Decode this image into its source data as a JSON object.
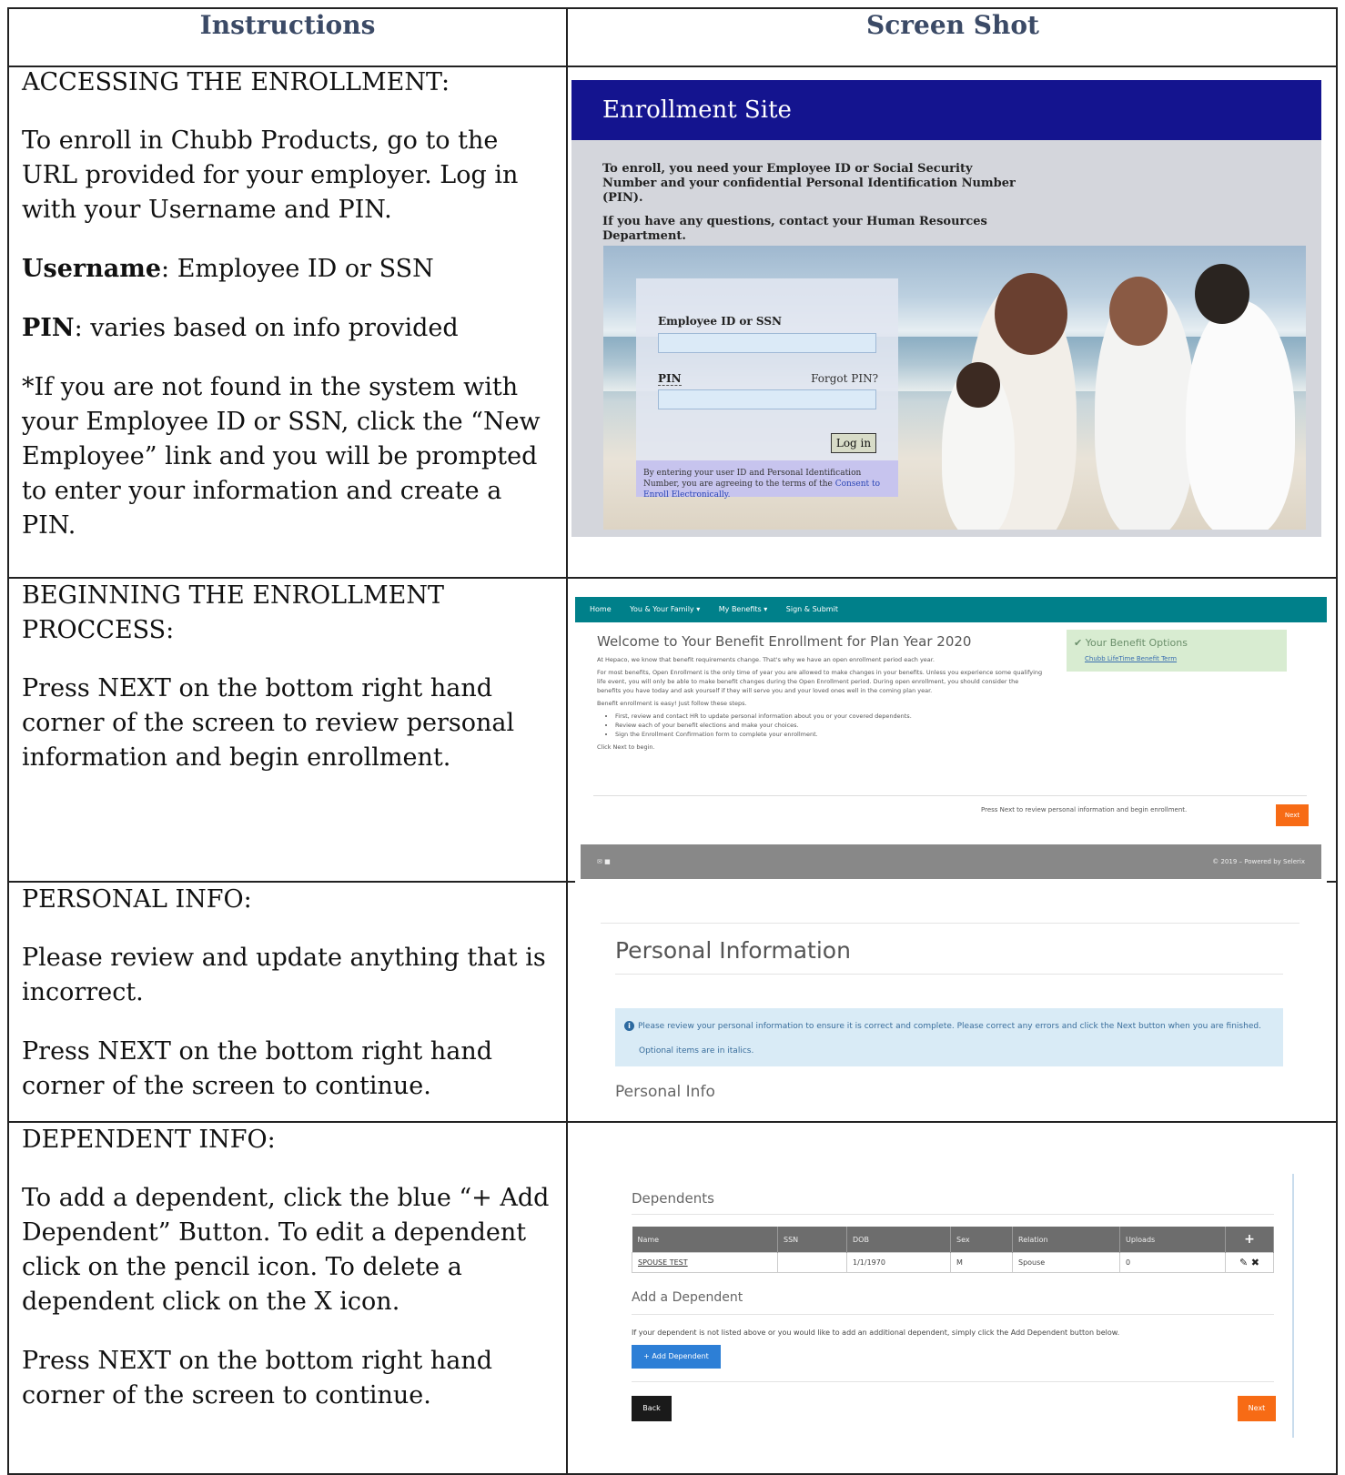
{
  "headers": {
    "instructions": "Instructions",
    "screenshot": "Screen Shot"
  },
  "sections": {
    "access": {
      "heading": "ACCESSING THE ENROLLMENT:",
      "body": "To enroll in Chubb Products, go to the URL provided for your employer. Log in with your Username and PIN.",
      "username_label": "Username",
      "username_value": ": Employee ID or SSN",
      "pin_label": "PIN",
      "pin_value": ": varies based on info provided",
      "note": "*If you are not found in the system with your Employee ID or SSN, click the “New Employee” link and you will be prompted to enter your information and create a PIN."
    },
    "begin": {
      "heading": "BEGINNING THE ENROLLMENT PROCCESS:",
      "body": "Press NEXT on the bottom right hand corner of the screen to review personal information and begin enrollment."
    },
    "personal": {
      "heading": "PERSONAL INFO:",
      "body": "Please review and update anything that is incorrect.",
      "body2": "Press NEXT on the bottom right hand corner of the screen to continue."
    },
    "dependent": {
      "heading": "DEPENDENT INFO:",
      "body": "To add a dependent, click the blue “+ Add Dependent” Button. To edit a dependent click on the pencil icon. To delete a dependent click on the X icon.",
      "body2": "Press NEXT on the bottom right hand corner of the screen to continue."
    }
  },
  "shot1": {
    "banner": "Enrollment Site",
    "intro1": "To enroll, you need your Employee ID or Social Security Number and your confidential Personal Identification Number (PIN).",
    "intro2": "If you have any questions, contact your Human Resources Department.",
    "id_label": "Employee ID or SSN",
    "pin_label": "PIN",
    "forgot": "Forgot PIN?",
    "login_btn": "Log in",
    "consent_text": "By entering your user ID and Personal Identification Number, you are agreeing to the terms of the ",
    "consent_link": "Consent to Enroll Electronically."
  },
  "shot2": {
    "nav": [
      "Home",
      "You & Your Family ▾",
      "My Benefits ▾",
      "Sign & Submit"
    ],
    "title": "Welcome to Your Benefit Enrollment for Plan Year 2020",
    "p1": "At Hepaco, we know that benefit requirements change. That's why we have an open enrollment period each year.",
    "p2": "For most benefits, Open Enrollment is the only time of year you are allowed to make changes in your benefits. Unless you experience some qualifying life event, you will only be able to make benefit changes during the Open Enrollment period. During open enrollment, you should consider the benefits you have today and ask yourself if they will serve you and your loved ones well in the coming plan year.",
    "p3": "Benefit enrollment is easy! Just follow these steps.",
    "steps": [
      "First, review and contact HR to update personal information about you or your covered dependents.",
      "Review each of your benefit elections and make your choices.",
      "Sign the Enrollment Confirmation form to complete your enrollment."
    ],
    "p4": "Click Next to begin.",
    "options_title": "✔ Your Benefit Options",
    "options_link": "Chubb LifeTime Benefit Term",
    "press": "Press Next to review personal information and begin enrollment.",
    "next": "Next",
    "footer_icons": "✉ ■",
    "copyright": "© 2019 – Powered by Selerix"
  },
  "shot3": {
    "title": "Personal Information",
    "info1": "Please review your personal information to ensure it is correct and complete. Please correct any errors and click the Next button when you are finished.",
    "info2": "Optional items are in italics.",
    "sub": "Personal Info"
  },
  "shot4": {
    "title": "Dependents",
    "columns": [
      "Name",
      "SSN",
      "DOB",
      "Sex",
      "Relation",
      "Uploads",
      "+"
    ],
    "row": [
      "SPOUSE TEST",
      "",
      "1/1/1970",
      "M",
      "Spouse",
      "0",
      "✎ ✖"
    ],
    "add_title": "Add a Dependent",
    "note": "If your dependent is not listed above or you would like to add an additional dependent, simply click the Add Dependent button below.",
    "add_btn": "+ Add Dependent",
    "back": "Back",
    "next": "Next"
  }
}
